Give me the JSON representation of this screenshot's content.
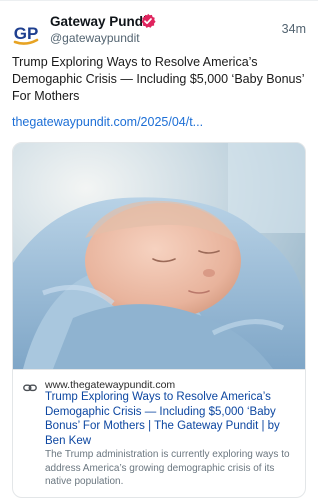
{
  "post": {
    "author": {
      "name": "Gateway Pundit",
      "handle": "@gatewaypundit",
      "avatar_text": "GP",
      "verified": true
    },
    "timestamp": "34m",
    "text": "Trump Exploring Ways to Resolve America’s Demogaphic Crisis — Including $5,000 ‘Baby Bonus’ For Mothers",
    "link_text": "thegatewaypundit.com/2025/04/t...",
    "link_card": {
      "image_description": "newborn baby sleeping wrapped in a blue blanket",
      "domain": "www.thegatewaypundit.com",
      "title": "Trump Exploring Ways to Resolve America’s Demogaphic Crisis — Including $5,000 ‘Baby Bonus’ For Mothers | The Gateway Pundit | by Ben Kew",
      "description": "The Trump administration is currently exploring ways to address America’s growing demographic crisis of its native population."
    }
  },
  "icons": {
    "verified": "verified-badge-icon",
    "link": "link-icon"
  },
  "colors": {
    "link": "#1d6fd6",
    "card_title": "#0d47a1",
    "verified": "#e0245e",
    "avatar_blue": "#1e3f8f",
    "avatar_gold": "#e7a323"
  }
}
